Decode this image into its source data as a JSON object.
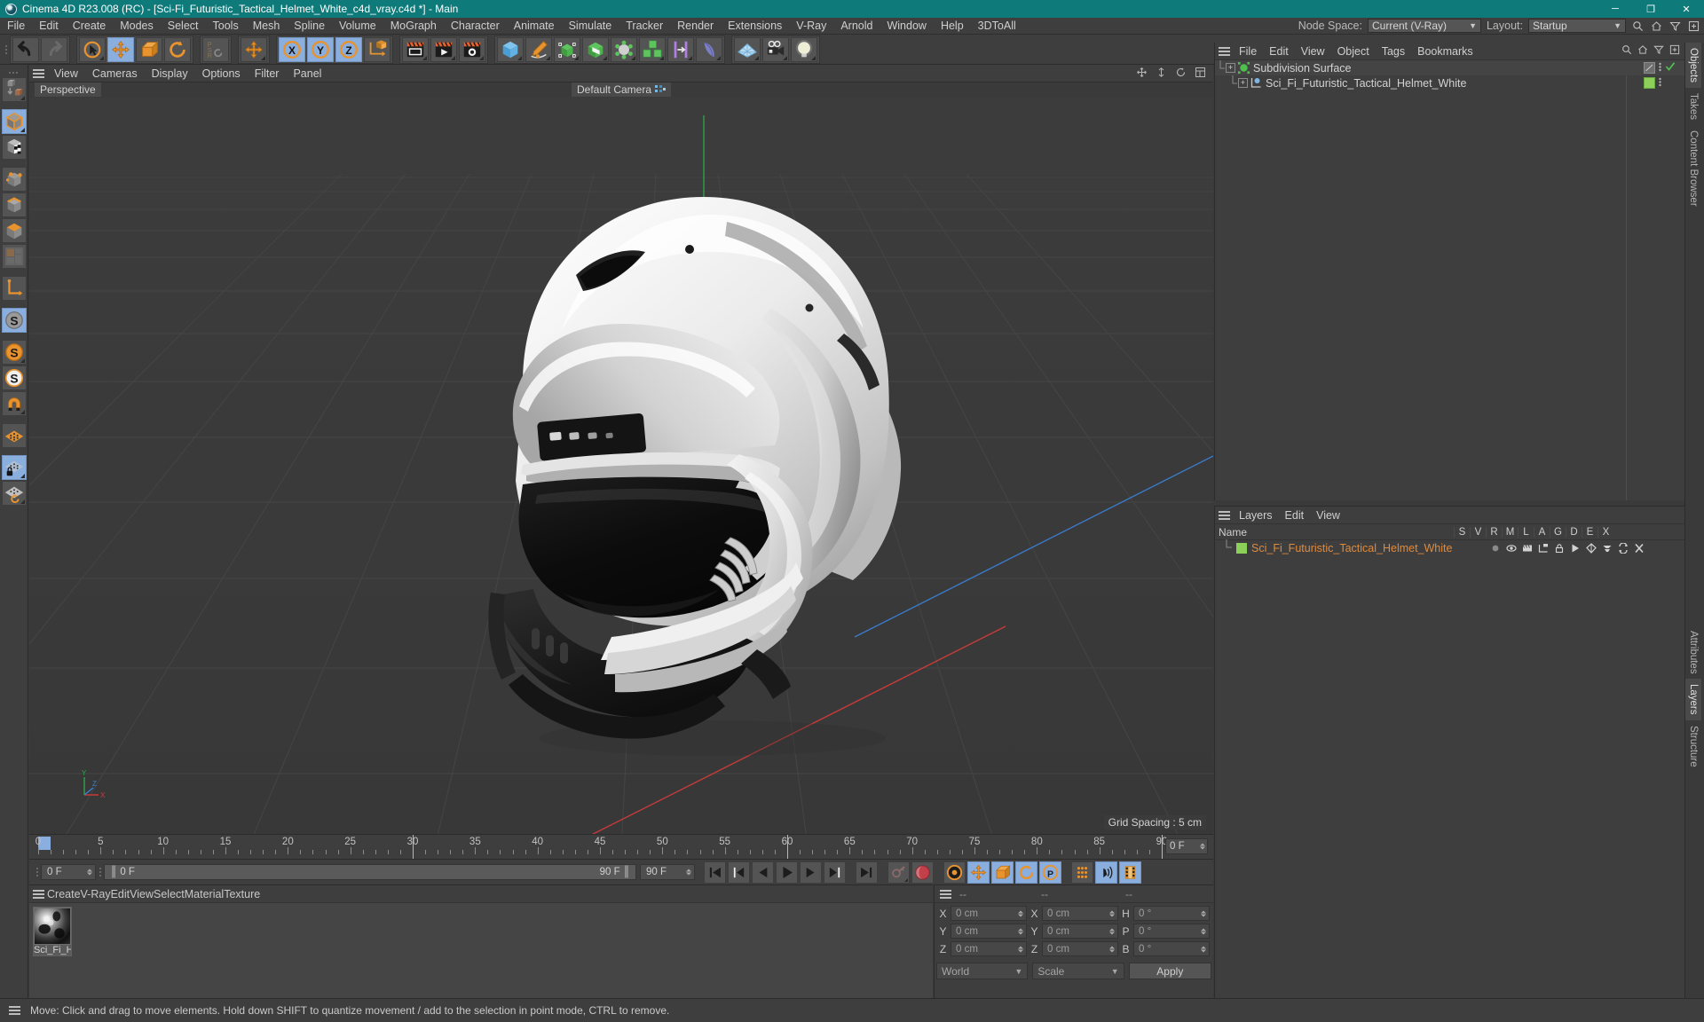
{
  "window": {
    "title": "Cinema 4D R23.008 (RC) - [Sci-Fi_Futuristic_Tactical_Helmet_White_c4d_vray.c4d *] - Main",
    "minimize": "─",
    "maximize": "❐",
    "close": "✕"
  },
  "menubar": {
    "items": [
      "File",
      "Edit",
      "Create",
      "Modes",
      "Select",
      "Tools",
      "Mesh",
      "Spline",
      "Volume",
      "MoGraph",
      "Character",
      "Animate",
      "Simulate",
      "Tracker",
      "Render",
      "Extensions",
      "V-Ray",
      "Arnold",
      "Window",
      "Help",
      "3DToAll"
    ],
    "node_space_label": "Node Space:",
    "node_space_value": "Current (V-Ray)",
    "layout_label": "Layout:",
    "layout_value": "Startup"
  },
  "toolbar": {
    "groups": [
      {
        "name": "undo-redo",
        "buttons": [
          {
            "name": "undo-button",
            "icon": "undo",
            "active": false,
            "corner": false
          },
          {
            "name": "redo-button",
            "icon": "redo",
            "active": false,
            "corner": false
          }
        ]
      },
      {
        "name": "transform-tools",
        "buttons": [
          {
            "name": "live-selection-tool",
            "icon": "select",
            "active": false,
            "corner": true
          },
          {
            "name": "move-tool",
            "icon": "move",
            "active": true,
            "corner": false
          },
          {
            "name": "scale-tool",
            "icon": "scale",
            "active": false,
            "corner": false
          },
          {
            "name": "rotate-tool",
            "icon": "rotate",
            "active": false,
            "corner": false
          }
        ]
      },
      {
        "name": "psr-group",
        "buttons": [
          {
            "name": "psr-toggle",
            "icon": "psr",
            "active": false,
            "corner": false
          }
        ]
      },
      {
        "name": "move-group",
        "buttons": [
          {
            "name": "move-axis-tool",
            "icon": "move",
            "active": false,
            "corner": true
          }
        ]
      },
      {
        "name": "axis-locks",
        "buttons": [
          {
            "name": "lock-x-axis-button",
            "icon": "x-axis",
            "active": true,
            "corner": false
          },
          {
            "name": "lock-y-axis-button",
            "icon": "y-axis",
            "active": true,
            "corner": false
          },
          {
            "name": "lock-z-axis-button",
            "icon": "z-axis",
            "active": true,
            "corner": false
          },
          {
            "name": "world-object-coordinate-button",
            "icon": "world-coord",
            "active": false,
            "corner": false
          }
        ]
      },
      {
        "name": "render-group",
        "buttons": [
          {
            "name": "render-view-button",
            "icon": "render-view",
            "active": false,
            "corner": true
          },
          {
            "name": "render-to-picture-viewer-button",
            "icon": "render-pv",
            "active": false,
            "corner": true
          },
          {
            "name": "render-settings-button",
            "icon": "render-settings",
            "active": false,
            "corner": true
          }
        ]
      },
      {
        "name": "create-group",
        "buttons": [
          {
            "name": "add-cube-button",
            "icon": "cube",
            "active": false,
            "corner": true
          },
          {
            "name": "add-spline-button",
            "icon": "pen",
            "active": false,
            "corner": true
          },
          {
            "name": "add-generator-button",
            "icon": "generator",
            "active": false,
            "corner": true
          },
          {
            "name": "add-deformer-button",
            "icon": "deformer",
            "active": false,
            "corner": true
          },
          {
            "name": "add-scene-object-button",
            "icon": "scene-obj",
            "active": false,
            "corner": true
          },
          {
            "name": "add-mograph-button",
            "icon": "mograph",
            "active": false,
            "corner": true
          },
          {
            "name": "add-field-button",
            "icon": "field",
            "active": false,
            "corner": true
          },
          {
            "name": "add-hair-button",
            "icon": "hair",
            "active": false,
            "corner": true
          }
        ]
      },
      {
        "name": "scene-group",
        "buttons": [
          {
            "name": "add-floor-button",
            "icon": "floor",
            "active": false,
            "corner": true
          },
          {
            "name": "add-camera-button",
            "icon": "camera",
            "active": false,
            "corner": true
          },
          {
            "name": "add-light-button",
            "icon": "light",
            "active": false,
            "corner": true
          }
        ]
      }
    ]
  },
  "left_toolbar": {
    "buttons": [
      {
        "name": "make-editable-button",
        "icon": "editable",
        "active": false,
        "corner": true
      },
      {
        "name": "model-mode-button",
        "icon": "model",
        "active": true,
        "corner": true
      },
      {
        "name": "texture-mode-button",
        "icon": "texture",
        "active": false,
        "corner": false
      },
      {
        "name": "points-mode-button",
        "icon": "points",
        "active": false,
        "corner": false
      },
      {
        "name": "edges-mode-button",
        "icon": "edges",
        "active": false,
        "corner": false
      },
      {
        "name": "polygons-mode-button",
        "icon": "polygons",
        "active": false,
        "corner": false
      },
      {
        "name": "uv-mode-button",
        "icon": "uvmode",
        "active": false,
        "corner": false
      },
      {
        "name": "axis-modify-button",
        "icon": "axis",
        "active": false,
        "corner": false
      },
      {
        "name": "enable-axis-button",
        "icon": "s-grey",
        "active": true,
        "corner": false
      },
      {
        "name": "object-axis-button",
        "icon": "s-orange",
        "active": false,
        "corner": true
      },
      {
        "name": "viewport-solo-button",
        "icon": "s-white",
        "active": false,
        "corner": false
      },
      {
        "name": "snap-button",
        "icon": "magnet",
        "active": false,
        "corner": true
      },
      {
        "name": "workplane-button",
        "icon": "workplane",
        "active": false,
        "corner": false
      },
      {
        "name": "lock-workplane-button",
        "icon": "workplane-lock",
        "active": true,
        "corner": true
      },
      {
        "name": "planar-workplane-button",
        "icon": "workplane-rotate",
        "active": false,
        "corner": true
      }
    ]
  },
  "viewport": {
    "menu": [
      "View",
      "Cameras",
      "Display",
      "Options",
      "Filter",
      "Panel"
    ],
    "projection_label": "Perspective",
    "camera_label": "Default Camera",
    "grid_spacing": "Grid Spacing : 5 cm",
    "axis_labels": [
      "Y",
      "Z",
      "X"
    ]
  },
  "timeline": {
    "ticks": [
      {
        "label": "0",
        "value": 0
      },
      {
        "label": "5",
        "value": 5
      },
      {
        "label": "10",
        "value": 10
      },
      {
        "label": "15",
        "value": 15
      },
      {
        "label": "20",
        "value": 20
      },
      {
        "label": "25",
        "value": 25
      },
      {
        "label": "30",
        "value": 30
      },
      {
        "label": "35",
        "value": 35
      },
      {
        "label": "40",
        "value": 40
      },
      {
        "label": "45",
        "value": 45
      },
      {
        "label": "50",
        "value": 50
      },
      {
        "label": "55",
        "value": 55
      },
      {
        "label": "60",
        "value": 60
      },
      {
        "label": "65",
        "value": 65
      },
      {
        "label": "70",
        "value": 70
      },
      {
        "label": "75",
        "value": 75
      },
      {
        "label": "80",
        "value": 80
      },
      {
        "label": "85",
        "value": 85
      },
      {
        "label": "90",
        "value": 90
      }
    ],
    "range_start": 0,
    "range_end": 90,
    "current_frame_field": "0 F",
    "playhead_frame": 0
  },
  "transport": {
    "current_frame": "0 F",
    "range_start": "0 F",
    "range_end": "90 F",
    "preview_end": "90 F",
    "buttons": [
      {
        "name": "go-to-start-button",
        "icon": "to-start",
        "active": false
      },
      {
        "name": "go-to-previous-key-button",
        "icon": "prev-key",
        "active": false
      },
      {
        "name": "go-to-previous-frame-button",
        "icon": "prev-frame",
        "active": false
      },
      {
        "name": "play-button",
        "icon": "play",
        "active": false
      },
      {
        "name": "go-to-next-frame-button",
        "icon": "next-frame",
        "active": false
      },
      {
        "name": "go-to-next-key-button",
        "icon": "next-key",
        "active": false
      },
      {
        "name": "go-to-end-button",
        "icon": "to-end",
        "active": false
      },
      {
        "name": "record-active-objects-button",
        "icon": "key-grey",
        "active": false
      },
      {
        "name": "autokeying-button",
        "icon": "record",
        "active": false
      },
      {
        "name": "keyframe-selection-button",
        "icon": "key-orange",
        "active": false
      },
      {
        "name": "position-key-button",
        "icon": "move",
        "active": true
      },
      {
        "name": "scale-key-button",
        "icon": "scale",
        "active": true
      },
      {
        "name": "rotation-key-button",
        "icon": "rotate",
        "active": true
      },
      {
        "name": "parameter-key-button",
        "icon": "param",
        "active": true
      },
      {
        "name": "point-level-animation-button",
        "icon": "pla",
        "active": false
      },
      {
        "name": "play-sound-button",
        "icon": "sound",
        "active": true
      },
      {
        "name": "timeline-button",
        "icon": "film",
        "active": true
      }
    ]
  },
  "material_manager": {
    "menu": [
      "Create",
      "V-Ray",
      "Edit",
      "View",
      "Select",
      "Material",
      "Texture"
    ],
    "materials": [
      {
        "name": "Sci_Fi_He",
        "selected": true
      }
    ]
  },
  "coordinates": {
    "header_cells": [
      "--",
      "--",
      "--"
    ],
    "rows": [
      {
        "label1": "X",
        "value1": "0 cm",
        "label2": "X",
        "value2": "0 cm",
        "label3": "H",
        "value3": "0 °"
      },
      {
        "label1": "Y",
        "value1": "0 cm",
        "label2": "Y",
        "value2": "0 cm",
        "label3": "P",
        "value3": "0 °"
      },
      {
        "label1": "Z",
        "value1": "0 cm",
        "label2": "Z",
        "value2": "0 cm",
        "label3": "B",
        "value3": "0 °"
      }
    ],
    "coord_system": "World",
    "mode": "Scale",
    "apply_label": "Apply"
  },
  "object_manager": {
    "menu": [
      "File",
      "Edit",
      "View",
      "Object",
      "Tags",
      "Bookmarks"
    ],
    "objects": [
      {
        "name": "Subdivision Surface",
        "indent": 0,
        "icon_color": "#4ec04e",
        "expanded": true,
        "has_tag": true,
        "tag_type": "phong",
        "checked": true
      },
      {
        "name": "Sci_Fi_Futuristic_Tactical_Helmet_White",
        "indent": 1,
        "icon_color": "#7fb5e0",
        "expanded": true,
        "has_tag": true,
        "tag_type": "material",
        "checked": false
      }
    ]
  },
  "layers_manager": {
    "menu": [
      "Layers",
      "Edit",
      "View"
    ],
    "name_column": "Name",
    "columns": [
      "S",
      "V",
      "R",
      "M",
      "L",
      "A",
      "G",
      "D",
      "E",
      "X"
    ],
    "rows": [
      {
        "name": "Sci_Fi_Futuristic_Tactical_Helmet_White",
        "color": "#8cd05a"
      }
    ]
  },
  "right_tabs": {
    "top": [
      "Objects",
      "Takes",
      "Content Browser"
    ],
    "bottom": [
      "Attributes",
      "Layers",
      "Structure"
    ],
    "top_active": "Objects",
    "bottom_active": "Layers"
  },
  "statusbar": {
    "message": "Move: Click and drag to move elements. Hold down SHIFT to quantize movement / add to the selection in point mode, CTRL to remove."
  },
  "colors": {
    "title_bg": "#0f7a7a",
    "accent_orange": "#e08a3c",
    "active_blue": "#8aaede",
    "panel_bg": "#3e3e3e",
    "viewport_bg": "#3a3a3a"
  }
}
